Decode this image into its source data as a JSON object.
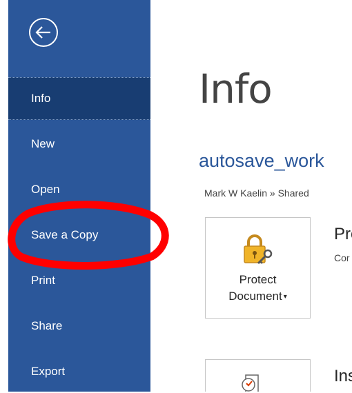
{
  "sidebar": {
    "back_label": "Back",
    "items": [
      {
        "label": "Info",
        "selected": true
      },
      {
        "label": "New"
      },
      {
        "label": "Open"
      },
      {
        "label": "Save a Copy"
      },
      {
        "label": "Print"
      },
      {
        "label": "Share"
      },
      {
        "label": "Export"
      }
    ]
  },
  "main": {
    "title": "Info",
    "doc_name": "autosave_work",
    "doc_path": "Mark W Kaelin » Shared",
    "protect": {
      "label_line1": "Protect",
      "label_line2": "Document",
      "heading": "Pro",
      "subtext": "Cor"
    },
    "inspect": {
      "heading": "Ins"
    }
  },
  "colors": {
    "sidebar_bg": "#2b579a",
    "selected_bg": "#183d72",
    "accent": "#2b579a",
    "annotation": "#ff0000"
  },
  "icons": [
    "back-arrow-icon",
    "lock-key-icon",
    "inspect-document-icon"
  ]
}
